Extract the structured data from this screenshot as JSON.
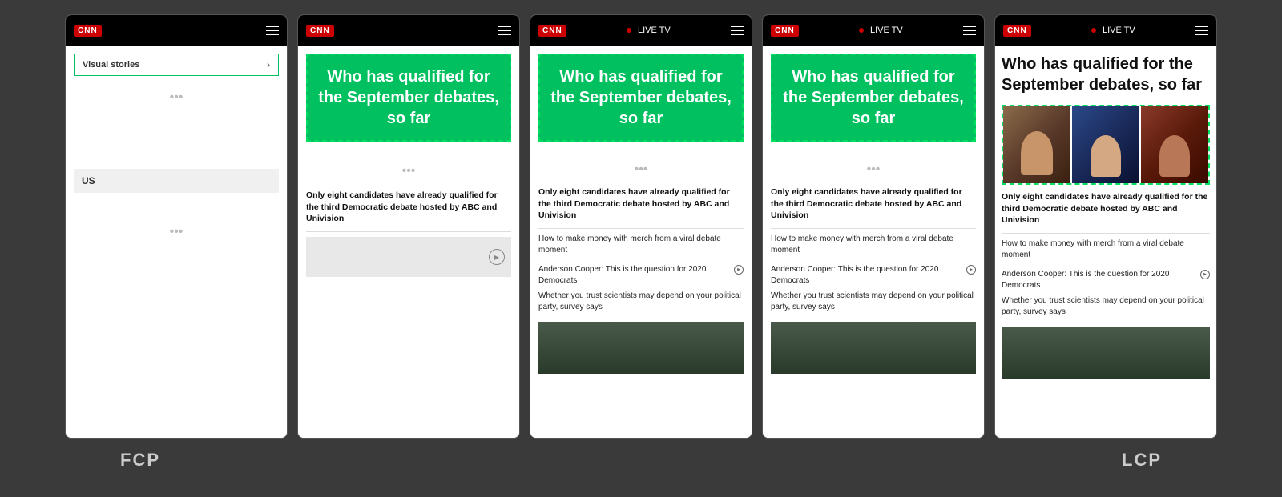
{
  "labels": {
    "fcp": "FCP",
    "lcp": "LCP"
  },
  "screens": [
    {
      "id": "screen1",
      "type": "blank",
      "bar": {
        "logo": "CNN",
        "showLiveTV": false
      },
      "visualStories": "Visual stories",
      "usLabel": "US"
    },
    {
      "id": "screen2",
      "type": "headline-only",
      "bar": {
        "logo": "CNN",
        "showLiveTV": false
      },
      "headline": "Who has qualified for the September debates, so far",
      "mainArticle": "Only eight candidates have already qualified for the third Democratic debate hosted by ABC and Univision"
    },
    {
      "id": "screen3",
      "type": "headline-articles",
      "bar": {
        "logo": "CNN",
        "showLiveTV": true,
        "liveTVLabel": "LIVE TV"
      },
      "headline": "Who has qualified for the September debates, so far",
      "mainArticle": "Only eight candidates have already qualified for the third Democratic debate hosted by ABC and Univision",
      "subArticles": [
        "How to make money with merch from a viral debate moment",
        "Anderson Cooper: This is the question for 2020 Democrats",
        "Whether you trust scientists may depend on your political party, survey says"
      ]
    },
    {
      "id": "screen4",
      "type": "headline-articles-image",
      "bar": {
        "logo": "CNN",
        "showLiveTV": true,
        "liveTVLabel": "LIVE TV"
      },
      "headline": "Who has qualified for the September debates, so far",
      "mainArticle": "Only eight candidates have already qualified for the third Democratic debate hosted by ABC and Univision",
      "subArticles": [
        "How to make money with merch from a viral debate moment",
        "Anderson Cooper: This is the question for 2020 Democrats",
        "Whether you trust scientists may depend on your political party, survey says"
      ]
    },
    {
      "id": "screen5",
      "type": "full-lcp",
      "bar": {
        "logo": "CNN",
        "showLiveTV": true,
        "liveTVLabel": "LIVE TV"
      },
      "headline": "Who has qualified for the September debates, so far",
      "mainArticle": "Only eight candidates have already qualified for the third Democratic debate hosted by ABC and Univision",
      "subArticles": [
        "How to make money with merch from a viral debate moment",
        "Anderson Cooper: This is the question for 2020 Democrats",
        "Whether you trust scientists may depend on your political party, survey says"
      ]
    }
  ]
}
